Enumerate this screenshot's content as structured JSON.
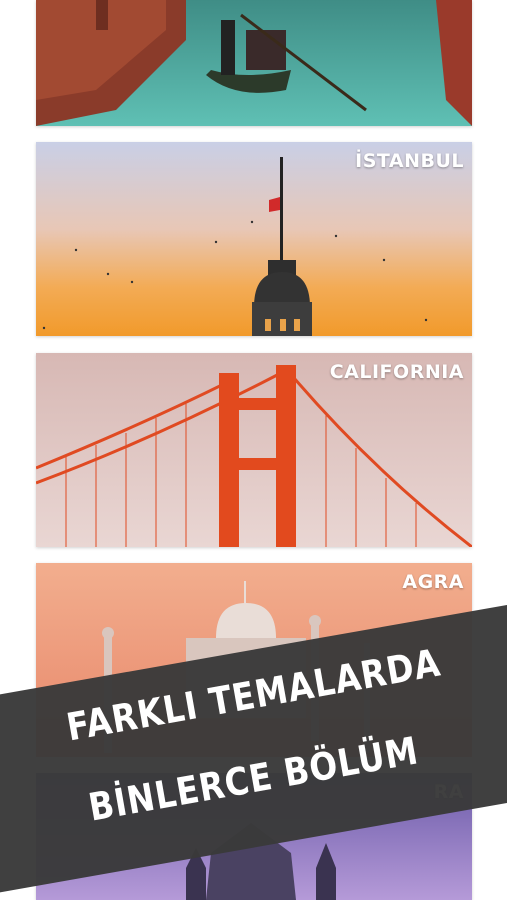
{
  "themes": [
    {
      "id": "venice",
      "label": ""
    },
    {
      "id": "istanbul",
      "label": "İSTANBUL"
    },
    {
      "id": "california",
      "label": "CALIFORNIA"
    },
    {
      "id": "agra",
      "label": "AGRA"
    },
    {
      "id": "fifth",
      "label": "RA"
    }
  ],
  "banner": {
    "line1": "FARKLI TEMALARDA",
    "line2": "BİNLERCE BÖLÜM"
  },
  "colors": {
    "banner_bg": "#3a3a3a",
    "label_text": "#ffffff"
  }
}
